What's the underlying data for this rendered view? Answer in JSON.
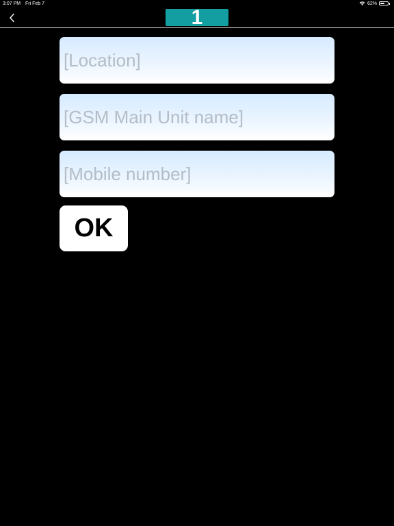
{
  "status_bar": {
    "time": "3:07 PM",
    "date": "Fri Feb 7",
    "battery": "62%",
    "battery_level": 0.62
  },
  "nav": {
    "title": "1",
    "title_bg_color": "#139ea2",
    "back_icon": "chevron-left-icon"
  },
  "form": {
    "location_placeholder": "[Location]",
    "unit_name_placeholder": "[GSM Main Unit name]",
    "mobile_placeholder": "[Mobile number]",
    "ok_label": "OK"
  }
}
